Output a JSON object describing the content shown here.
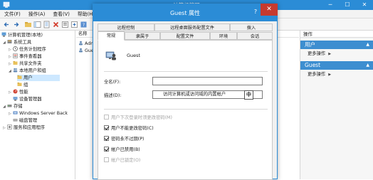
{
  "window": {
    "title": "计算机管理",
    "min": "─",
    "max": "☐",
    "close": "✕"
  },
  "menu": [
    "文件(F)",
    "操作(A)",
    "查看(V)",
    "帮助(H)"
  ],
  "tree": {
    "items": [
      {
        "label": "计算机管理(本地)",
        "indent": 0,
        "arrow": "",
        "icon": "computer"
      },
      {
        "label": "系统工具",
        "indent": 1,
        "arrow": "◢",
        "icon": "tools"
      },
      {
        "label": "任务计划程序",
        "indent": 2,
        "arrow": "▷",
        "icon": "clock"
      },
      {
        "label": "事件查看器",
        "indent": 2,
        "arrow": "▷",
        "icon": "event"
      },
      {
        "label": "共享文件夹",
        "indent": 2,
        "arrow": "▷",
        "icon": "folder"
      },
      {
        "label": "本地用户和组",
        "indent": 2,
        "arrow": "◢",
        "icon": "users"
      },
      {
        "label": "用户",
        "indent": 3,
        "arrow": "",
        "icon": "folder-small",
        "selected": true
      },
      {
        "label": "组",
        "indent": 3,
        "arrow": "",
        "icon": "folder-small"
      },
      {
        "label": "性能",
        "indent": 2,
        "arrow": "▷",
        "icon": "perf"
      },
      {
        "label": "设备管理器",
        "indent": 2,
        "arrow": "",
        "icon": "device"
      },
      {
        "label": "存储",
        "indent": 1,
        "arrow": "◢",
        "icon": "storage"
      },
      {
        "label": "Windows Server Back",
        "indent": 2,
        "arrow": "▷",
        "icon": "backup"
      },
      {
        "label": "磁盘管理",
        "indent": 2,
        "arrow": "",
        "icon": "disk"
      },
      {
        "label": "服务和应用程序",
        "indent": 1,
        "arrow": "▷",
        "icon": "services"
      }
    ]
  },
  "center": {
    "column": "名称",
    "rows": [
      "Adm",
      "Gues"
    ]
  },
  "actions": {
    "header": "操作",
    "sections": [
      {
        "title": "用户",
        "item": "更多操作"
      },
      {
        "title": "Guest",
        "item": "更多操作"
      }
    ]
  },
  "dialog": {
    "title": "Guest 属性",
    "help": "?",
    "close": "✕",
    "tabs_row1": [
      "远程控制",
      "远程桌面服务配置文件",
      "拨入"
    ],
    "tabs_row2": [
      "常规",
      "隶属于",
      "配置文件",
      "环境",
      "会话"
    ],
    "active_tab": "常规",
    "user_name": "Guest",
    "fullname_label": "全名(F):",
    "fullname_value": "",
    "desc_label": "描述(D):",
    "desc_value": "访问计算机或访问域的内置帐户",
    "ime_indicator": "中",
    "checkboxes": [
      {
        "label": "用户下次登录时须更改密码(M)",
        "checked": false,
        "disabled": true
      },
      {
        "label": "用户不能更改密码(C)",
        "checked": true,
        "disabled": false
      },
      {
        "label": "密码永不过期(P)",
        "checked": true,
        "disabled": false
      },
      {
        "label": "帐户已禁用(B)",
        "checked": true,
        "disabled": false
      },
      {
        "label": "帐户已锁定(O)",
        "checked": false,
        "disabled": true
      }
    ]
  },
  "colors": {
    "titlebar": "#2b8cd6",
    "action_section": "#3d8ed0",
    "close_red": "#c73a2e",
    "selection": "#cde8ff"
  }
}
